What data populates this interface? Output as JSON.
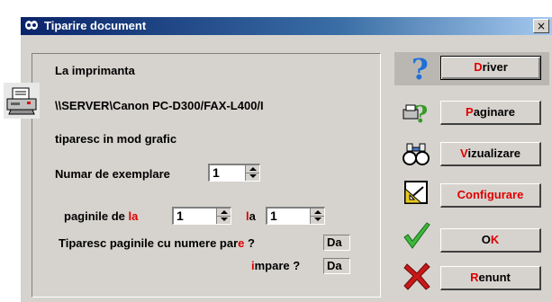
{
  "window": {
    "title": "Tiparire document",
    "close": "×"
  },
  "form": {
    "printer_label": "La imprimanta",
    "printer_name": "\\\\SERVER\\Canon PC-D300/FAX-L400/I",
    "mode_label": "tiparesc in mod grafic",
    "copies_label": "Numar de exemplare",
    "copies_value": "1",
    "pages_label_a": "paginile  de ",
    "pages_label_hot1": "l",
    "pages_label_hot2": "a",
    "pages_from_value": "1",
    "pages_to_hot": "l",
    "pages_to_rest": "a",
    "pages_to_value": "1",
    "even_label_a": "Tiparesc paginile cu numere par",
    "even_label_hot": "e",
    "even_label_b": " ?",
    "even_value": "Da",
    "odd_hot": "i",
    "odd_label_b": "mpare ?",
    "odd_value": "Da"
  },
  "buttons": {
    "driver": {
      "hot": "D",
      "rest": "river"
    },
    "paginare": {
      "hot": "P",
      "rest": "aginare"
    },
    "vizualizare": {
      "hot": "V",
      "rest": "izualizare"
    },
    "configurare": {
      "label": "Configurare"
    },
    "ok": {
      "a": "O",
      "hot": "K"
    },
    "renunt": {
      "hot": "R",
      "rest": "enunt"
    }
  },
  "colors": {
    "hotkey": "#e00000",
    "titlebar": "#0a246a",
    "dialog": "#d6d3ce"
  },
  "icons": [
    "printer-icon",
    "question-icon",
    "paginare-icon",
    "binoculars-icon",
    "configure-icon",
    "checkmark-icon",
    "cross-icon",
    "window-icon"
  ]
}
